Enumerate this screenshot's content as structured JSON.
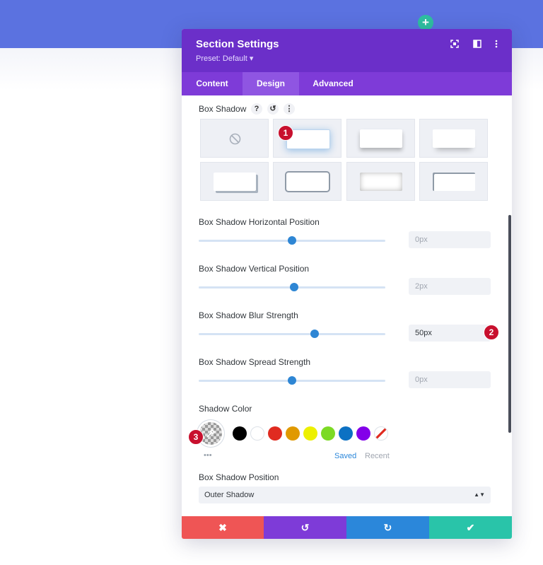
{
  "modal": {
    "title": "Section Settings",
    "preset": "Preset: Default ▾",
    "icons": [
      "expand-icon",
      "sidebar-icon",
      "more-vertical-icon"
    ]
  },
  "tabs": [
    {
      "label": "Content",
      "active": false
    },
    {
      "label": "Design",
      "active": true
    },
    {
      "label": "Advanced",
      "active": false
    }
  ],
  "box_shadow": {
    "label": "Box Shadow",
    "help": "?",
    "reset": "↺",
    "more": "⋮",
    "presets": [
      "none",
      "preset-1",
      "preset-2",
      "preset-3",
      "preset-4",
      "preset-5",
      "preset-6",
      "preset-7"
    ],
    "selected_preset": "preset-1"
  },
  "sliders": [
    {
      "label": "Box Shadow Horizontal Position",
      "value": "0px",
      "position": 0.5,
      "active": false
    },
    {
      "label": "Box Shadow Vertical Position",
      "value": "2px",
      "position": 0.51,
      "active": false
    },
    {
      "label": "Box Shadow Blur Strength",
      "value": "50px",
      "position": 0.62,
      "active": true
    },
    {
      "label": "Box Shadow Spread Strength",
      "value": "0px",
      "position": 0.5,
      "active": false
    }
  ],
  "shadow_color": {
    "label": "Shadow Color",
    "swatches": [
      "#000000",
      "#ffffff",
      "#e02b20",
      "#e09900",
      "#edf000",
      "#7cda24",
      "#0c71c3",
      "#8300e9"
    ],
    "saved": "Saved",
    "recent": "Recent",
    "more": "•••"
  },
  "shadow_position": {
    "label": "Box Shadow Position",
    "value": "Outer Shadow"
  },
  "badges": [
    "1",
    "2",
    "3"
  ],
  "footer": {
    "cancel": "✖",
    "undo": "↺",
    "redo": "↻",
    "save": "✔",
    "colors": [
      "#ef5555",
      "#7e3bd8",
      "#2b87da",
      "#29c4a9"
    ]
  },
  "add_button": "+"
}
